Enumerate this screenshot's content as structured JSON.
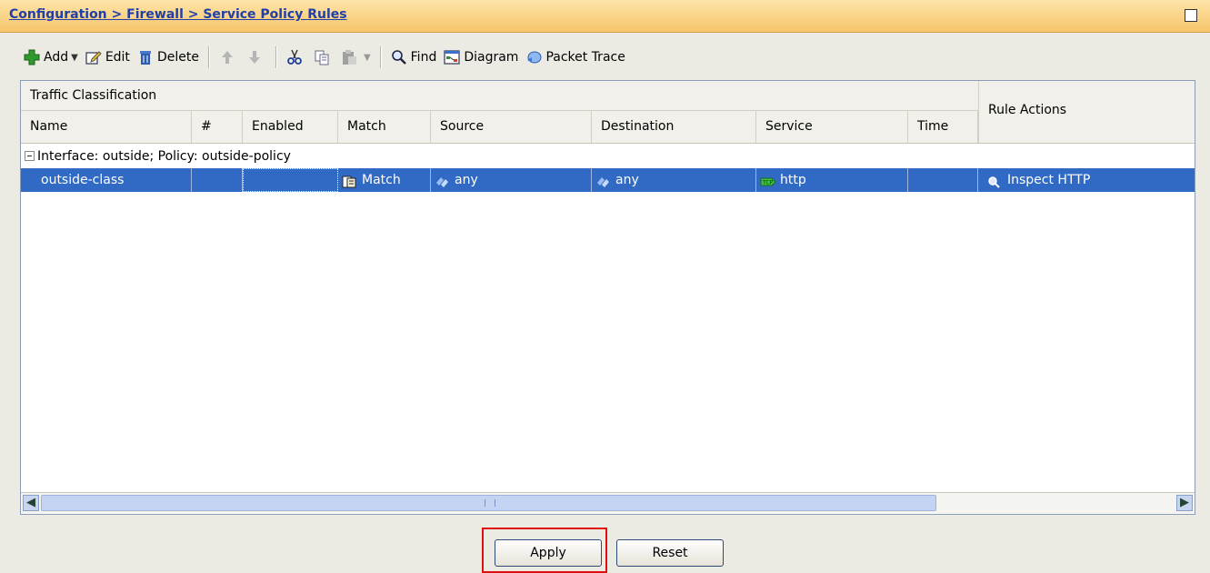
{
  "titlebar": {
    "breadcrumb": "Configuration > Firewall > Service Policy Rules"
  },
  "toolbar": {
    "add": "Add",
    "edit": "Edit",
    "delete": "Delete",
    "find": "Find",
    "diagram": "Diagram",
    "packet_trace": "Packet Trace"
  },
  "table": {
    "group_header": "Traffic Classification",
    "rule_actions_header": "Rule Actions",
    "columns": [
      "Name",
      "#",
      "Enabled",
      "Match",
      "Source",
      "Destination",
      "Service",
      "Time"
    ],
    "group_row": "Interface: outside; Policy: outside-policy",
    "rows": [
      {
        "name": "outside-class",
        "number": "",
        "enabled": "",
        "match": "Match",
        "source": "any",
        "destination": "any",
        "service": "http",
        "time": "",
        "rule_action": "Inspect HTTP"
      }
    ]
  },
  "buttons": {
    "apply": "Apply",
    "reset": "Reset"
  },
  "colors": {
    "selected_row": "#316ac5",
    "titlebar": "#f7c56b",
    "highlight_box": "#e01010"
  }
}
